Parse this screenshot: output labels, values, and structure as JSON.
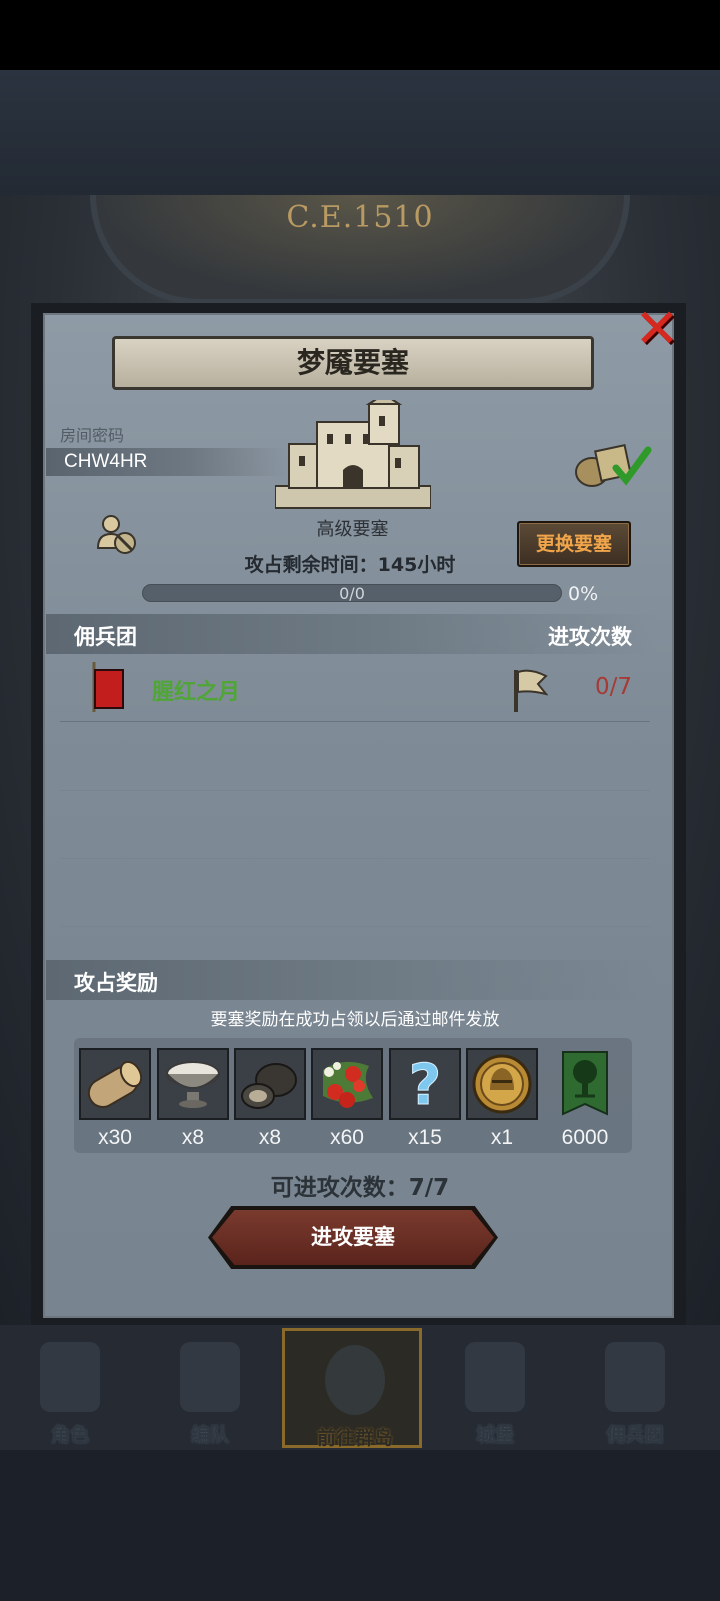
{
  "header": {
    "year": "C.E.1510"
  },
  "dialog": {
    "title": "梦魇要塞",
    "room_label": "房间密码",
    "room_code": "CHW4HR",
    "fortress_level": "高级要塞",
    "change_button": "更换要塞",
    "time_left": "攻占剩余时间：145小时",
    "progress": {
      "text": "0/0",
      "percent_label": "0%",
      "fraction": 0
    }
  },
  "mercenary": {
    "header": "佣兵团",
    "attacks_header": "进攻次数",
    "rows": [
      {
        "name": "腥红之月",
        "attacks": "0/7"
      }
    ]
  },
  "rewards": {
    "header": "攻占奖励",
    "note": "要塞奖励在成功占领以后通过邮件发放",
    "items": [
      {
        "icon": "wood-log-icon",
        "qty": "x30"
      },
      {
        "icon": "silver-bowl-icon",
        "qty": "x8"
      },
      {
        "icon": "truffle-icon",
        "qty": "x8"
      },
      {
        "icon": "berries-icon",
        "qty": "x60"
      },
      {
        "icon": "question-mark-icon",
        "qty": "x15"
      },
      {
        "icon": "knight-helmet-coin-icon",
        "qty": "x1"
      },
      {
        "icon": "tree-banner-icon",
        "qty": "6000"
      }
    ]
  },
  "attack": {
    "count_label": "可进攻次数：7/7",
    "button": "进攻要塞"
  },
  "nav": {
    "items": [
      {
        "label": "角色"
      },
      {
        "label": "编队"
      },
      {
        "label": "前往群岛",
        "active": true
      },
      {
        "label": "城堡"
      },
      {
        "label": "佣兵团"
      }
    ]
  },
  "colors": {
    "accent_orange": "#f1a54a",
    "merc_green": "#4fa637",
    "attacks_red": "#a63a34",
    "close_red": "#d6281f"
  }
}
